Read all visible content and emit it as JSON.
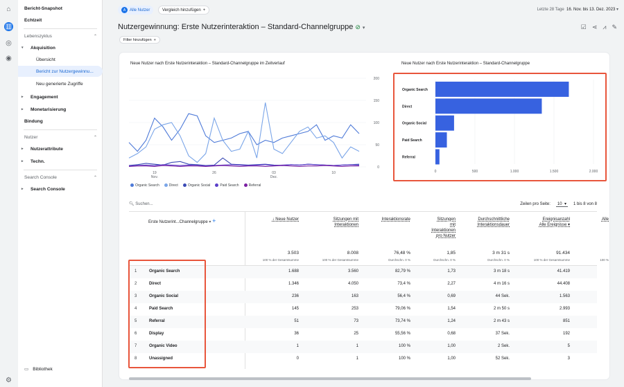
{
  "rail": {
    "icons": [
      "home-icon",
      "reports-icon",
      "explore-icon",
      "advertising-icon",
      "settings-icon"
    ]
  },
  "nav": {
    "snapshot": "Bericht-Snapshot",
    "realtime": "Echtzeit",
    "lifecycle": "Lebenszyklus",
    "acquisition": "Akquisition",
    "overview": "Übersicht",
    "user_acq": "Bericht zur Nutzergewinnu...",
    "new_traffic": "Neu generierte Zugriffe",
    "engagement": "Engagement",
    "monetization": "Monetarisierung",
    "retention": "Bindung",
    "users_section": "Nutzer",
    "user_attributes": "Nutzerattribute",
    "tech": "Techn.",
    "search_console_section": "Search Console",
    "search_console": "Search Console",
    "library": "Bibliothek"
  },
  "topbar": {
    "audience_avatar": "A",
    "audience": "Alle Nutzer",
    "compare": "Vergleich hinzufügen",
    "date_label": "Letzte 28 Tage",
    "date_range": "16. Nov. bis 13. Dez. 2023"
  },
  "page": {
    "title": "Nutzergewinnung: Erste Nutzerinteraktion – Standard-Channelgruppe",
    "filter": "Filter hinzufügen"
  },
  "line_chart": {
    "title": "Neue Nutzer nach Erste Nutzerinteraktion – Standard-Channelgruppe im Zeitverlauf",
    "x_ticks": [
      {
        "day": "19",
        "month": "Nov."
      },
      {
        "day": "26",
        "month": ""
      },
      {
        "day": "03",
        "month": "Dez."
      },
      {
        "day": "10",
        "month": ""
      }
    ],
    "y_ticks": [
      "200",
      "150",
      "100",
      "50",
      "0"
    ],
    "legend": [
      "Organic Search",
      "Direct",
      "Organic Social",
      "Paid Search",
      "Referral"
    ]
  },
  "bar_title": "Neue Nutzer nach Erste Nutzerinteraktion – Standard-Channelgruppe",
  "chart_data": [
    {
      "type": "line",
      "title": "Neue Nutzer nach Erste Nutzerinteraktion – Standard-Channelgruppe im Zeitverlauf",
      "x": [
        "16.11",
        "17.11",
        "18.11",
        "19.11",
        "20.11",
        "21.11",
        "22.11",
        "23.11",
        "24.11",
        "25.11",
        "26.11",
        "27.11",
        "28.11",
        "29.11",
        "30.11",
        "01.12",
        "02.12",
        "03.12",
        "04.12",
        "05.12",
        "06.12",
        "07.12",
        "08.12",
        "09.12",
        "10.12",
        "11.12",
        "12.12",
        "13.12"
      ],
      "ylim": [
        0,
        200
      ],
      "series": [
        {
          "name": "Organic Search",
          "color": "#4e7ad8",
          "values": [
            55,
            35,
            60,
            110,
            90,
            60,
            85,
            120,
            115,
            70,
            55,
            60,
            65,
            75,
            80,
            50,
            60,
            55,
            65,
            70,
            75,
            80,
            95,
            60,
            70,
            65,
            95,
            75
          ]
        },
        {
          "name": "Direct",
          "color": "#7aa5e8",
          "values": [
            20,
            30,
            45,
            85,
            95,
            100,
            70,
            25,
            10,
            30,
            110,
            60,
            35,
            40,
            80,
            20,
            145,
            40,
            30,
            55,
            80,
            90,
            65,
            70,
            55,
            20,
            45,
            35
          ]
        },
        {
          "name": "Organic Social",
          "color": "#3b4bb5",
          "values": [
            3,
            5,
            8,
            6,
            4,
            10,
            12,
            6,
            5,
            3,
            4,
            20,
            6,
            5,
            4,
            5,
            6,
            4,
            3,
            5,
            4,
            6,
            5,
            4,
            3,
            4,
            5,
            6
          ]
        },
        {
          "name": "Paid Search",
          "color": "#5b3fc9",
          "values": [
            2,
            3,
            4,
            3,
            5,
            4,
            3,
            4,
            3,
            2,
            3,
            4,
            5,
            4,
            3,
            4,
            5,
            3,
            4,
            5,
            4,
            6,
            5,
            4,
            3,
            4,
            5,
            4
          ]
        },
        {
          "name": "Referral",
          "color": "#7b1fa2",
          "values": [
            1,
            2,
            2,
            1,
            3,
            2,
            1,
            2,
            2,
            1,
            2,
            3,
            2,
            1,
            2,
            2,
            1,
            2,
            3,
            2,
            1,
            2,
            2,
            3,
            2,
            1,
            2,
            2
          ]
        }
      ]
    },
    {
      "type": "bar",
      "title": "Neue Nutzer nach Erste Nutzerinteraktion – Standard-Channelgruppe",
      "categories": [
        "Organic Search",
        "Direct",
        "Organic Social",
        "Paid Search",
        "Referral"
      ],
      "values": [
        1688,
        1346,
        236,
        145,
        51
      ],
      "x_ticks": [
        "0",
        "500",
        "1.000",
        "1.500",
        "2.000"
      ],
      "xlim": [
        0,
        2000
      ],
      "color": "#3762e0"
    }
  ],
  "table": {
    "search_placeholder": "Suchen...",
    "rows_per_page_label": "Zeilen pro Seite:",
    "rows_per_page": "10",
    "range": "1 bis 8 von 8",
    "dim_header": "Erste Nutzerint...Channelgruppe",
    "headers": [
      {
        "lines": [
          "↓ Neue Nutzer"
        ],
        "total": "3.503",
        "sub": "100 % der Gesamtsumme"
      },
      {
        "lines": [
          "Sitzungen mit",
          "Interaktionen"
        ],
        "total": "8.008",
        "sub": "100 % der Gesamtsumme"
      },
      {
        "lines": [
          "Interaktionsrate"
        ],
        "total": "76,48 %",
        "sub": "Durchschn. 0 %"
      },
      {
        "lines": [
          "Sitzungen",
          "mit",
          "Interaktionen",
          "pro Nutzer"
        ],
        "total": "1,85",
        "sub": "Durchschn. 0 %"
      },
      {
        "lines": [
          "Durchschnittliche",
          "Interaktionsdauer"
        ],
        "total": "3 m 31 s",
        "sub": "Durchschn. 0 %"
      },
      {
        "lines": [
          "Ereignisanzahl",
          "Alle Ereignisse ▾"
        ],
        "total": "91.434",
        "sub": "100 % der Gesamtsumme"
      },
      {
        "lines": [
          "Alle"
        ],
        "total": "",
        "sub": "100 %"
      }
    ],
    "rows": [
      {
        "idx": "1",
        "name": "Organic Search",
        "v": [
          "1.688",
          "3.560",
          "82,79 %",
          "1,73",
          "3 m 18 s",
          "41.419"
        ]
      },
      {
        "idx": "2",
        "name": "Direct",
        "v": [
          "1.346",
          "4.050",
          "73,4 %",
          "2,27",
          "4 m 16 s",
          "44.408"
        ]
      },
      {
        "idx": "3",
        "name": "Organic Social",
        "v": [
          "236",
          "163",
          "56,4 %",
          "0,69",
          "44 Sek.",
          "1.563"
        ]
      },
      {
        "idx": "4",
        "name": "Paid Search",
        "v": [
          "145",
          "253",
          "79,06 %",
          "1,54",
          "2 m 50 s",
          "2.993"
        ]
      },
      {
        "idx": "5",
        "name": "Referral",
        "v": [
          "51",
          "73",
          "73,74 %",
          "1,24",
          "2 m 43 s",
          "851"
        ]
      },
      {
        "idx": "6",
        "name": "Display",
        "v": [
          "36",
          "25",
          "55,56 %",
          "0,68",
          "37 Sek.",
          "192"
        ]
      },
      {
        "idx": "7",
        "name": "Organic Video",
        "v": [
          "1",
          "1",
          "100 %",
          "1,00",
          "2 Sek.",
          "5"
        ]
      },
      {
        "idx": "8",
        "name": "Unassigned",
        "v": [
          "0",
          "1",
          "100 %",
          "1,00",
          "52 Sek.",
          "3"
        ]
      }
    ]
  }
}
